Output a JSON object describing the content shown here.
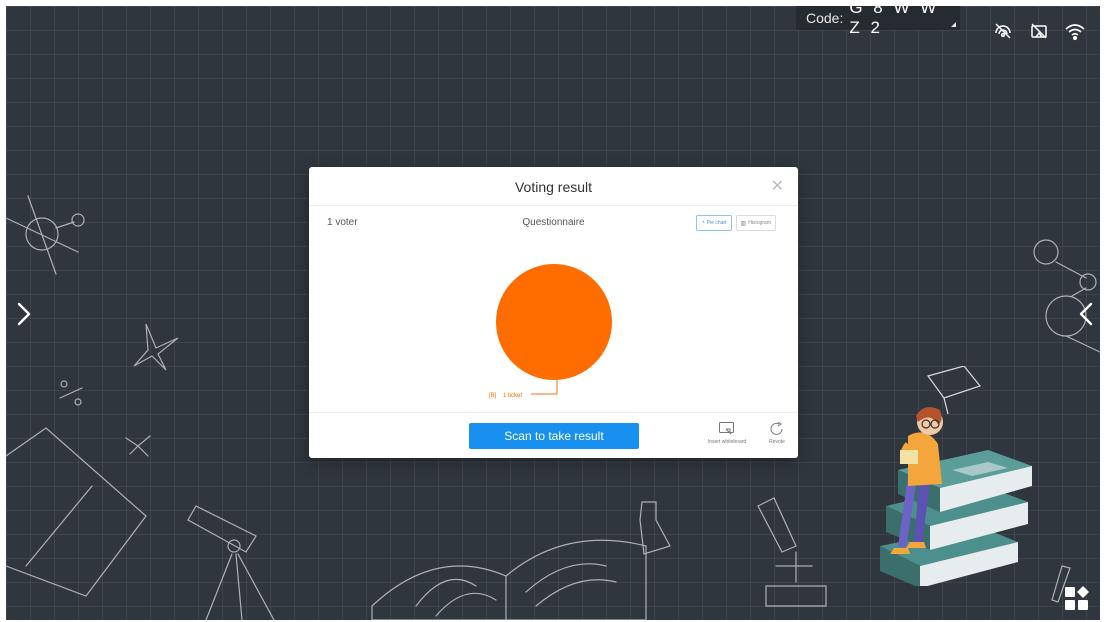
{
  "header": {
    "code_label": "Code:",
    "code_value": "G 8 W W Z 2",
    "status_icons": [
      "screen-share-off-icon",
      "screen-mirror-off-icon",
      "wifi-icon"
    ]
  },
  "navigation": {
    "left_arrow": "chevron-right-icon",
    "right_arrow": "chevron-left-icon",
    "apps_button": "apps-grid-icon"
  },
  "dialog": {
    "title": "Voting result",
    "close_icon": "close-icon",
    "voters": "1 voter",
    "questionnaire": "Questionnaire",
    "tabs": [
      {
        "label": "Pie chart",
        "icon": "pie-chart-icon",
        "active": true
      },
      {
        "label": "Histogram",
        "icon": "histogram-icon",
        "active": false
      }
    ],
    "scan_button": "Scan to take result",
    "actions": [
      {
        "label": "Insert whiteboard",
        "icon": "insert-whiteboard-icon"
      },
      {
        "label": "Revote",
        "icon": "revote-icon"
      }
    ]
  },
  "chart_data": {
    "type": "pie",
    "slices": [
      {
        "label": "[B]",
        "value": 1,
        "value_label": "1 ticket",
        "color": "#ff6d00"
      }
    ]
  },
  "colors": {
    "board": "#2f363d",
    "accent": "#1890f0",
    "pie": "#ff6d00"
  }
}
